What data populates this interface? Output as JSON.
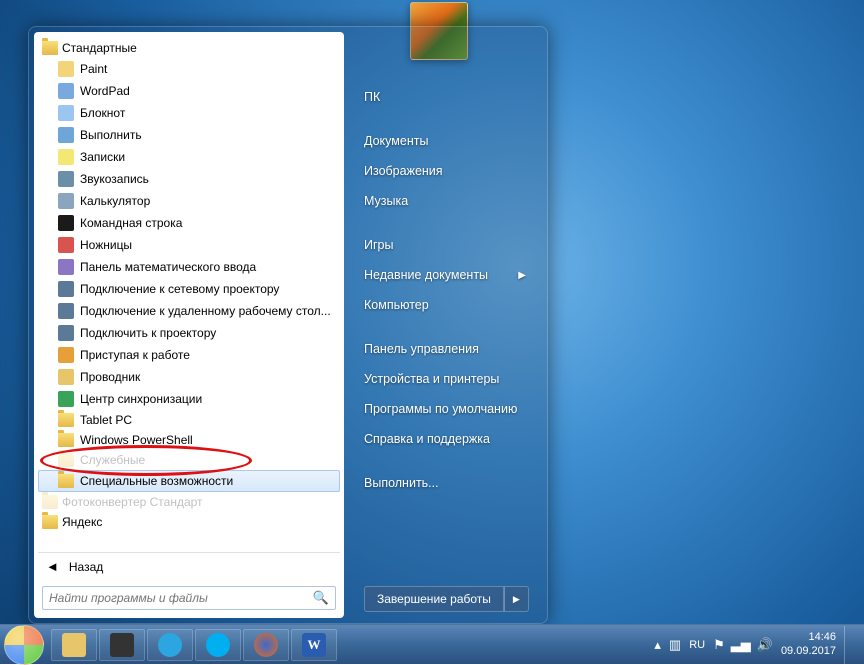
{
  "start_menu": {
    "folder_label": "Стандартные",
    "programs": [
      {
        "label": "Paint",
        "color": "#f2d57a"
      },
      {
        "label": "WordPad",
        "color": "#7aa9e0"
      },
      {
        "label": "Блокнот",
        "color": "#9cc5ef"
      },
      {
        "label": "Выполнить",
        "color": "#6fa6d8"
      },
      {
        "label": "Записки",
        "color": "#f2e873"
      },
      {
        "label": "Звукозапись",
        "color": "#6b8fa8"
      },
      {
        "label": "Калькулятор",
        "color": "#8aa5bd"
      },
      {
        "label": "Командная строка",
        "color": "#1a1a1a"
      },
      {
        "label": "Ножницы",
        "color": "#d9534f"
      },
      {
        "label": "Панель математического ввода",
        "color": "#8a76c2"
      },
      {
        "label": "Подключение к сетевому проектору",
        "color": "#5a7a98"
      },
      {
        "label": "Подключение к удаленному рабочему стол...",
        "color": "#5a7a98"
      },
      {
        "label": "Подключить к проектору",
        "color": "#5a7a98"
      },
      {
        "label": "Приступая к работе",
        "color": "#e79f3a"
      },
      {
        "label": "Проводник",
        "color": "#e7c56a"
      },
      {
        "label": "Центр синхронизации",
        "color": "#3aa35a"
      }
    ],
    "subfolders": [
      {
        "label": "Tablet PC"
      },
      {
        "label": "Windows PowerShell"
      },
      {
        "label": "Служебные",
        "obscured": true
      },
      {
        "label": "Специальные возможности",
        "highlighted": true
      }
    ],
    "outer_folders": [
      {
        "label": "Фотоконвертер Стандарт",
        "obscured": true
      },
      {
        "label": "Яндекс"
      }
    ],
    "back_label": "Назад",
    "search_placeholder": "Найти программы и файлы"
  },
  "right_pane": {
    "items_top": [
      "ПК"
    ],
    "items_mid": [
      "Документы",
      "Изображения",
      "Музыка"
    ],
    "items_mid2": [
      "Игры",
      "Недавние документы",
      "Компьютер"
    ],
    "items_bot": [
      "Панель управления",
      "Устройства и принтеры",
      "Программы по умолчанию",
      "Справка и поддержка"
    ],
    "items_run": [
      "Выполнить..."
    ],
    "has_submenu_index": 1,
    "shutdown_label": "Завершение работы"
  },
  "taskbar": {
    "lang": "RU",
    "time": "14:46",
    "date": "09.09.2017"
  }
}
